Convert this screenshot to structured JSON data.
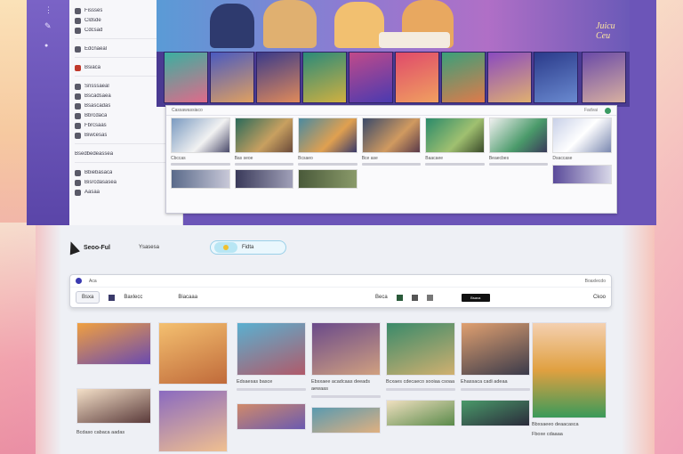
{
  "menu": {
    "groups": [
      {
        "items": [
          {
            "label": "Fissses"
          },
          {
            "label": "Cldsde"
          },
          {
            "label": "Cdcsad"
          }
        ]
      },
      {
        "items": [
          {
            "label": "Edcnaeal"
          }
        ]
      },
      {
        "items": [
          {
            "label": "Bsiaca"
          }
        ]
      },
      {
        "items": [
          {
            "label": "Snsssaeal"
          },
          {
            "label": "Bscadsaea"
          },
          {
            "label": "Bsascadas"
          },
          {
            "label": "Bbrcdaca"
          },
          {
            "label": "Fbrcsaas"
          },
          {
            "label": "Biwcesas"
          }
        ]
      },
      {
        "items": [
          {
            "label": "Bsedbedeassea"
          }
        ]
      },
      {
        "items": [
          {
            "label": "Bbiebasaca"
          },
          {
            "label": "Bisrcdasasea"
          },
          {
            "label": "Aasaa"
          }
        ]
      }
    ]
  },
  "hero": {
    "title": "Juicu  Ceu"
  },
  "inner": {
    "toolbar_left": "Cassawassiaco",
    "toolbar_right": "Fadvai",
    "cards": [
      {
        "caption": "Cbccas"
      },
      {
        "caption": "Bas seoe"
      },
      {
        "caption": "Bcsaeo"
      },
      {
        "caption": "Bce ase"
      },
      {
        "caption": "Baacaee"
      },
      {
        "caption": "Beaecbes"
      },
      {
        "caption": "Dsaccase"
      }
    ]
  },
  "brand": {
    "name": "Seoo-Ful",
    "tag": "Ysasesa"
  },
  "search": {
    "value": "Fidta"
  },
  "toolbar": {
    "left_label": "Aca",
    "chip": "Bsxa",
    "tab1": "Baxlecc",
    "tab2": "Biacaaa",
    "mid": "Beca",
    "right_link": "Boaxlecdo",
    "right2": "Ckoo",
    "btn": "Bsaxa"
  },
  "gallery": {
    "captions": [
      "Bcdaso cabaca aadas",
      "Edsaesas basce",
      "Ebsxaee acadcaas deeads aewaas",
      "Bcxaes cdecaeco sooiaa csoaa",
      "Ehassaca cadi adeaa",
      "Bbxsaeeo deaacasca",
      "Fboxe cdaaaa"
    ]
  },
  "colors": {
    "accent": "#6c55b8",
    "hero_band": "#4a3a92",
    "brand_dark": "#111111"
  }
}
